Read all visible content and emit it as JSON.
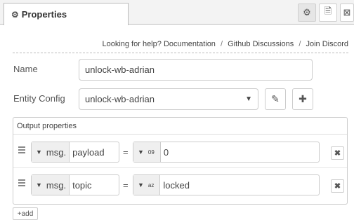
{
  "tab": {
    "title": "Properties",
    "icon": "gear-icon"
  },
  "tab_buttons": [
    {
      "icon": "gear-icon",
      "glyph": "⚙"
    },
    {
      "icon": "document-icon",
      "glyph": "🗎"
    },
    {
      "icon": "layout-icon",
      "glyph": "⊠"
    }
  ],
  "help": {
    "prefix": "Looking for help?",
    "links": [
      "Documentation",
      "Github Discussions",
      "Join Discord"
    ],
    "separator": "/"
  },
  "form": {
    "name_label": "Name",
    "name_value": "unlock-wb-adrian",
    "entity_label": "Entity Config",
    "entity_value": "unlock-wb-adrian"
  },
  "output": {
    "header": "Output properties",
    "rows": [
      {
        "lhs_type": "msg.",
        "lhs_value": "payload",
        "eq": "=",
        "rhs_type_icon": "09",
        "rhs_value": "0"
      },
      {
        "lhs_type": "msg.",
        "lhs_value": "topic",
        "eq": "=",
        "rhs_type_icon": "az",
        "rhs_value": "locked"
      }
    ],
    "add_label": "add"
  }
}
